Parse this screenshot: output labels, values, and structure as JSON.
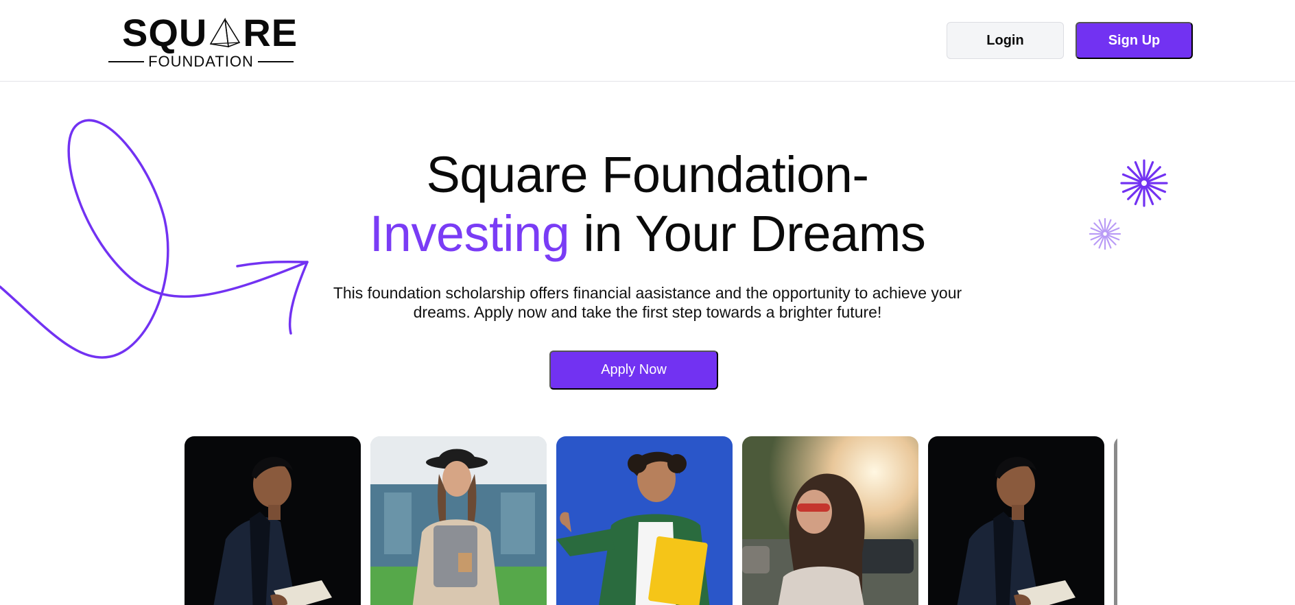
{
  "header": {
    "logo": {
      "word_left": "SQU",
      "word_right": "RE",
      "subtitle": "FOUNDATION",
      "icon": "pyramid-icon"
    },
    "login_label": "Login",
    "signup_label": "Sign Up"
  },
  "hero": {
    "title_line1": "Square Foundation-",
    "title_accent": "Investing",
    "title_rest": " in Your Dreams",
    "description": "This foundation scholarship offers financial aasistance and the opportunity to achieve your dreams. Apply now and take the first step towards a brighter future!",
    "cta_label": "Apply Now"
  },
  "decorations": {
    "swirl": "swirl-arrow-icon",
    "bursts": [
      "starburst-icon",
      "starburst-icon"
    ]
  },
  "gallery": {
    "photos": [
      "student-man-with-book-photo",
      "student-woman-with-laptop-photo",
      "student-man-with-folder-photo",
      "student-woman-in-sun-photo",
      "student-man-with-book-photo",
      "partial-photo"
    ]
  },
  "colors": {
    "accent": "#7232f2",
    "accent_text": "#7a3cf5",
    "login_bg": "#f4f5f7"
  }
}
